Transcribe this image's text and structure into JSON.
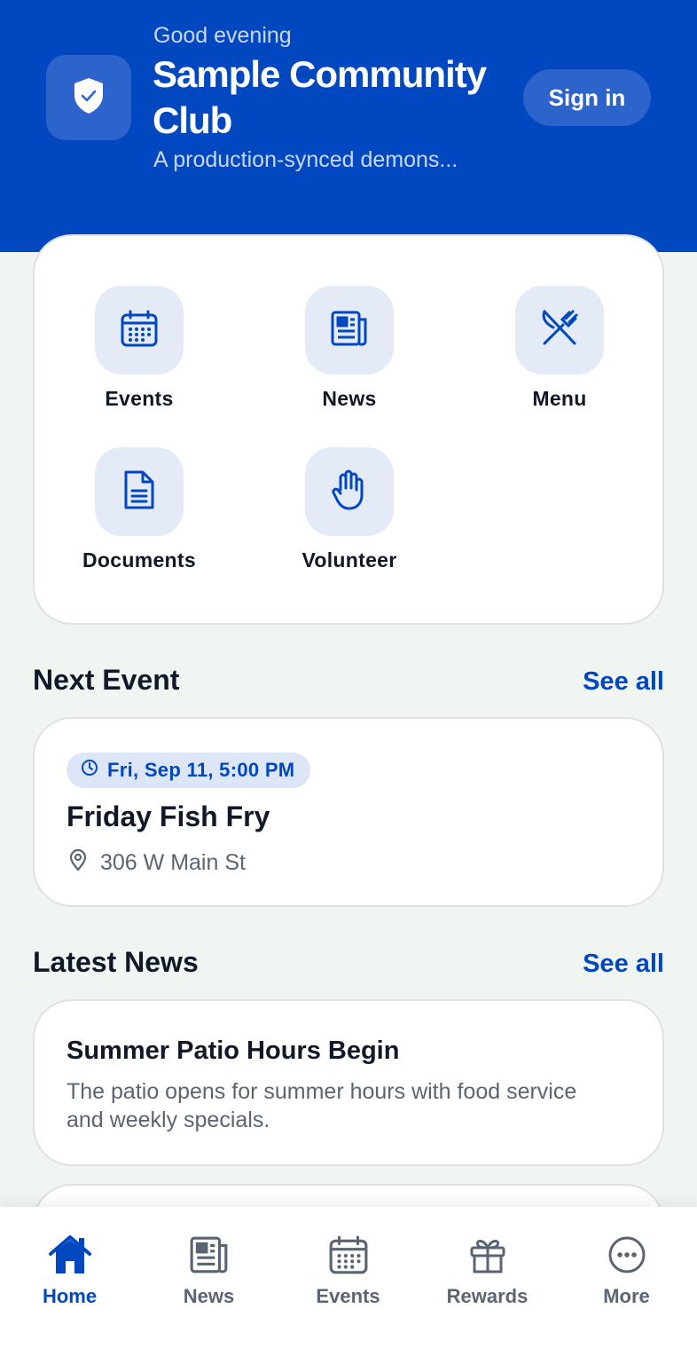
{
  "header": {
    "greeting": "Good evening",
    "club_name": "Sample Community Club",
    "tagline": "A production-synced demons...",
    "sign_in_label": "Sign in",
    "logo_icon": "shield-check-icon"
  },
  "quick_actions": [
    {
      "label": "Events",
      "icon": "calendar-icon"
    },
    {
      "label": "News",
      "icon": "newspaper-icon"
    },
    {
      "label": "Menu",
      "icon": "fork-knife-icon"
    },
    {
      "label": "Documents",
      "icon": "document-icon"
    },
    {
      "label": "Volunteer",
      "icon": "hand-icon"
    }
  ],
  "next_event": {
    "section_title": "Next Event",
    "see_all": "See all",
    "datetime": "Fri, Sep 11, 5:00 PM",
    "title": "Friday Fish Fry",
    "location": "306 W Main St"
  },
  "latest_news": {
    "section_title": "Latest News",
    "see_all": "See all",
    "items": [
      {
        "title": "Summer Patio Hours Begin",
        "excerpt": "The patio opens for summer hours with food service and weekly specials."
      }
    ]
  },
  "bottom_nav": [
    {
      "label": "Home",
      "icon": "home-icon",
      "active": true
    },
    {
      "label": "News",
      "icon": "newspaper-icon",
      "active": false
    },
    {
      "label": "Events",
      "icon": "calendar-icon",
      "active": false
    },
    {
      "label": "Rewards",
      "icon": "gift-icon",
      "active": false
    },
    {
      "label": "More",
      "icon": "more-icon",
      "active": false
    }
  ],
  "colors": {
    "brand": "#0047c0",
    "background": "#f1f5f2",
    "muted_text": "#5b6472"
  }
}
